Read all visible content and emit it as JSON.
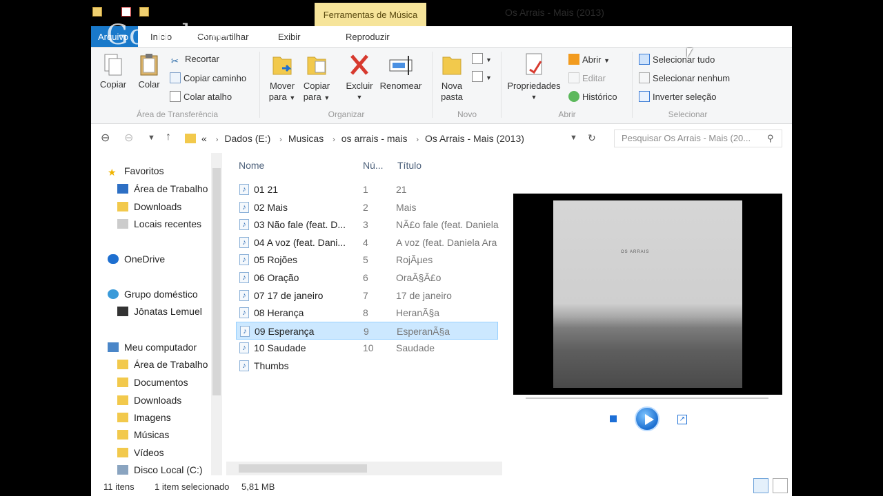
{
  "titlebar": {
    "tools_tab": "Ferramentas de Música",
    "window_title": "Os Arrais - Mais (2013)"
  },
  "overlay": {
    "watermark": "Google+"
  },
  "tabs": {
    "file": "Arquivo",
    "home": "Início",
    "share": "Compartilhar",
    "view": "Exibir",
    "play": "Reproduzir"
  },
  "ribbon": {
    "copy": "Copiar",
    "paste": "Colar",
    "cut": "Recortar",
    "copy_path": "Copiar caminho",
    "paste_shortcut": "Colar atalho",
    "group_clipboard": "Área de Transferência",
    "move_to_1": "Mover",
    "move_to_2": "para",
    "copy_to_1": "Copiar",
    "copy_to_2": "para",
    "delete": "Excluir",
    "rename": "Renomear",
    "group_organize": "Organizar",
    "new_folder_1": "Nova",
    "new_folder_2": "pasta",
    "group_new": "Novo",
    "properties": "Propriedades",
    "open": "Abrir",
    "edit": "Editar",
    "history": "Histórico",
    "group_open": "Abrir",
    "select_all": "Selecionar tudo",
    "select_none": "Selecionar nenhum",
    "invert_selection": "Inverter seleção",
    "group_select": "Selecionar"
  },
  "address": {
    "overflow": "«",
    "crumbs": [
      "Dados (E:)",
      "Musicas",
      "os arrais - mais",
      "Os Arrais - Mais (2013)"
    ],
    "search_placeholder": "Pesquisar Os Arrais - Mais (20..."
  },
  "nav": {
    "favorites": "Favoritos",
    "desktop": "Área de Trabalho",
    "downloads": "Downloads",
    "recent": "Locais recentes",
    "onedrive": "OneDrive",
    "homegroup": "Grupo doméstico",
    "user": "Jônatas Lemuel",
    "computer": "Meu computador",
    "pc_desktop": "Área de Trabalho",
    "documents": "Documentos",
    "pc_downloads": "Downloads",
    "images": "Imagens",
    "music": "Músicas",
    "videos": "Vídeos",
    "local_disk": "Disco Local (C:)"
  },
  "list": {
    "headers": {
      "name": "Nome",
      "number": "Nú...",
      "title": "Título"
    },
    "rows": [
      {
        "name": "01 21",
        "num": "1",
        "title": "21"
      },
      {
        "name": "02 Mais",
        "num": "2",
        "title": "Mais"
      },
      {
        "name": "03 Não fale (feat. D...",
        "num": "3",
        "title": "NÃ£o fale (feat. Daniela"
      },
      {
        "name": "04 A voz (feat. Dani...",
        "num": "4",
        "title": "A voz (feat. Daniela Ara"
      },
      {
        "name": "05 Rojões",
        "num": "5",
        "title": "RojÃµes"
      },
      {
        "name": "06 Oração",
        "num": "6",
        "title": "OraÃ§Ã£o"
      },
      {
        "name": "07 17 de janeiro",
        "num": "7",
        "title": "17 de janeiro"
      },
      {
        "name": "08 Herança",
        "num": "8",
        "title": "HeranÃ§a"
      },
      {
        "name": "09 Esperança",
        "num": "9",
        "title": "EsperanÃ§a"
      },
      {
        "name": "10 Saudade",
        "num": "10",
        "title": "Saudade"
      },
      {
        "name": "Thumbs",
        "num": "",
        "title": ""
      }
    ]
  },
  "preview": {
    "cover_text": "OS ARRAIS"
  },
  "status": {
    "count": "11 itens",
    "selected": "1 item selecionado",
    "size": "5,81 MB"
  },
  "colors": {
    "accent": "#1979ca",
    "selection": "#cce8ff",
    "tools_tab": "#f6e49a"
  }
}
